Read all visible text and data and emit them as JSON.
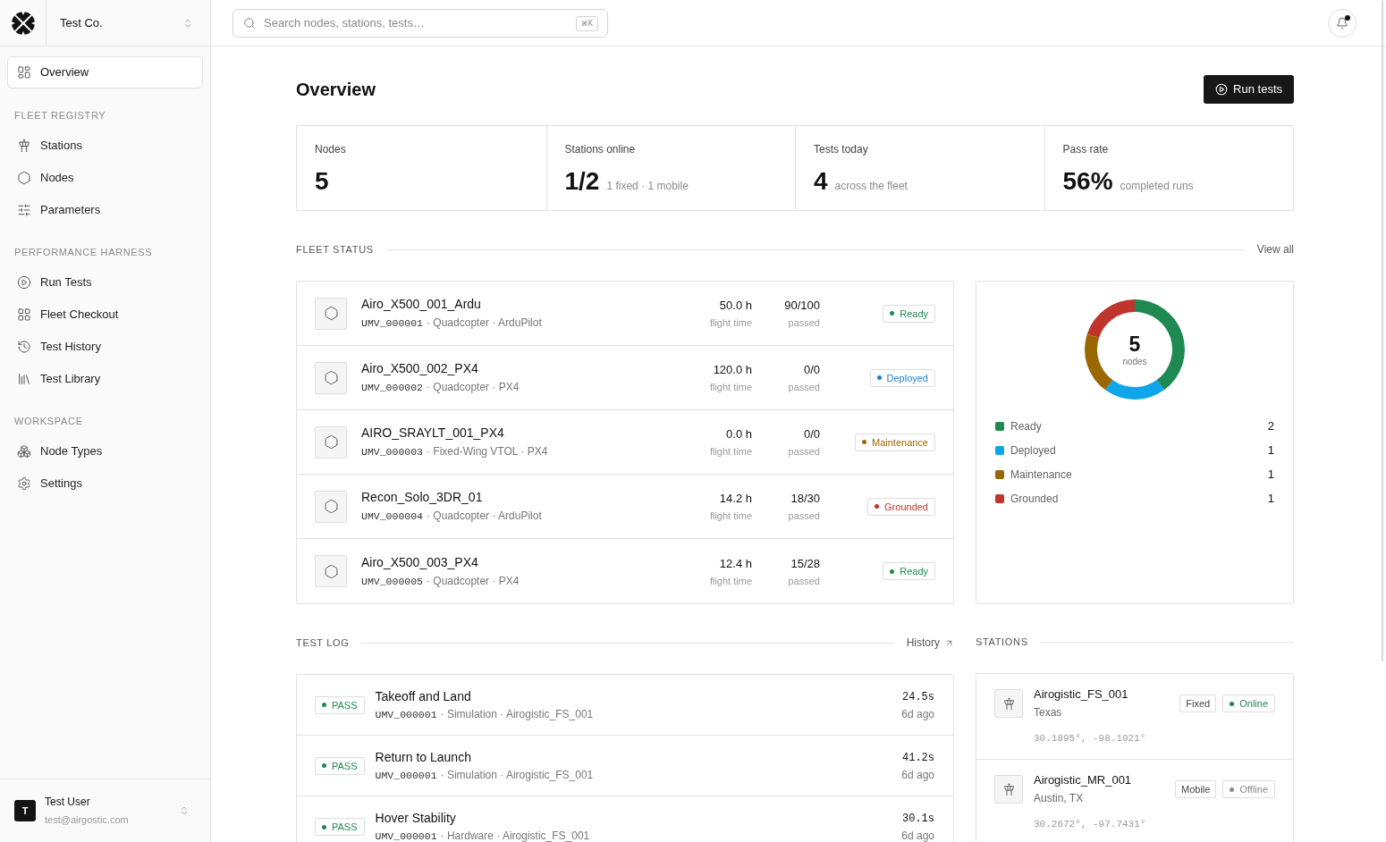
{
  "sidebar": {
    "company": "Test Co.",
    "top_items": [
      {
        "label": "Overview",
        "selected": true
      }
    ],
    "sections": [
      {
        "title": "FLEET REGISTRY",
        "items": [
          {
            "label": "Stations",
            "selected": false
          },
          {
            "label": "Nodes",
            "selected": false
          },
          {
            "label": "Parameters",
            "selected": false
          }
        ]
      },
      {
        "title": "PERFORMANCE HARNESS",
        "items": [
          {
            "label": "Run Tests",
            "selected": false
          },
          {
            "label": "Fleet Checkout",
            "selected": false
          },
          {
            "label": "Test History",
            "selected": false
          },
          {
            "label": "Test Library",
            "selected": false
          }
        ]
      },
      {
        "title": "WORKSPACE",
        "items": [
          {
            "label": "Node Types",
            "selected": false
          },
          {
            "label": "Settings",
            "selected": false
          }
        ]
      }
    ],
    "user": {
      "initial": "T",
      "name": "Test User",
      "email": "test@airgostic.com"
    }
  },
  "header": {
    "search": {
      "placeholder": "Search nodes, stations, tests…",
      "shortcut": "⌘K"
    },
    "notifications": {
      "unread": true
    }
  },
  "page": {
    "title": "Overview",
    "action": "Run tests"
  },
  "stats": [
    {
      "label": "Nodes",
      "value": "5"
    },
    {
      "label": "Stations online",
      "value": "1/2",
      "note": "1 fixed · 1 mobile"
    },
    {
      "label": "Tests today",
      "value": "4",
      "note": "across the fleet"
    },
    {
      "label": "Pass rate",
      "value": "56%",
      "note": "completed runs"
    }
  ],
  "fleet_status": {
    "title": "FLEET STATUS",
    "link": "View all",
    "nodes": [
      {
        "name": "Airo_X500_001_Ardu",
        "id": "UMV_000001",
        "meta": "· Quadcopter · ArduPilot",
        "flight_time": "50.0 h",
        "flight_time_label": "flight time",
        "passed": "90/100",
        "passed_label": "passed",
        "status": "Ready",
        "color": "#1e8a52"
      },
      {
        "name": "Airo_X500_002_PX4",
        "id": "UMV_000002",
        "meta": "· Quadcopter · PX4",
        "flight_time": "120.0 h",
        "flight_time_label": "flight time",
        "passed": "0/0",
        "passed_label": "passed",
        "status": "Deployed",
        "color": "#1a7fd0"
      },
      {
        "name": "AIRO_SRAYLT_001_PX4",
        "id": "UMV_000003",
        "meta": "· Fixed-Wing VTOL · PX4",
        "flight_time": "0.0 h",
        "flight_time_label": "flight time",
        "passed": "0/0",
        "passed_label": "passed",
        "status": "Maintenance",
        "color": "#9a6700"
      },
      {
        "name": "Recon_Solo_3DR_01",
        "id": "UMV_000004",
        "meta": "· Quadcopter · ArduPilot",
        "flight_time": "14.2 h",
        "flight_time_label": "flight time",
        "passed": "18/30",
        "passed_label": "passed",
        "status": "Grounded",
        "color": "#c0352b"
      },
      {
        "name": "Airo_X500_003_PX4",
        "id": "UMV_000005",
        "meta": "· Quadcopter · PX4",
        "flight_time": "12.4 h",
        "flight_time_label": "flight time",
        "passed": "15/28",
        "passed_label": "passed",
        "status": "Ready",
        "color": "#1e8a52"
      }
    ],
    "summary": {
      "total": "5",
      "total_label": "nodes",
      "chart_data": {
        "type": "donut",
        "values": [
          40,
          20,
          20,
          20
        ]
      },
      "legend": [
        {
          "label": "Ready",
          "count": "2",
          "color": "#1e8a52"
        },
        {
          "label": "Deployed",
          "count": "1",
          "color": "#0ea5e9"
        },
        {
          "label": "Maintenance",
          "count": "1",
          "color": "#9a6700"
        },
        {
          "label": "Grounded",
          "count": "1",
          "color": "#c0352b"
        }
      ]
    }
  },
  "test_log": {
    "title": "TEST LOG",
    "link": "History",
    "runs": [
      {
        "result": "PASS",
        "passed": true,
        "title": "Takeoff and Land",
        "node": "UMV_000001",
        "meta": "· Simulation · Airogistic_FS_001",
        "duration": "24.5s",
        "ago": "6d ago"
      },
      {
        "result": "PASS",
        "passed": true,
        "title": "Return to Launch",
        "node": "UMV_000001",
        "meta": "· Simulation · Airogistic_FS_001",
        "duration": "41.2s",
        "ago": "6d ago"
      },
      {
        "result": "PASS",
        "passed": true,
        "title": "Hover Stability",
        "node": "UMV_000001",
        "meta": "· Hardware · Airogistic_FS_001",
        "duration": "30.1s",
        "ago": "6d ago"
      }
    ]
  },
  "stations": {
    "title": "STATIONS",
    "items": [
      {
        "name": "Airogistic_FS_001",
        "location": "Texas",
        "mode": "Fixed",
        "status": "Online",
        "online": true,
        "coordinates": "30.1895°, -98.1021°"
      },
      {
        "name": "Airogistic_MR_001",
        "location": "Austin, TX",
        "mode": "Mobile",
        "status": "Offline",
        "online": false,
        "coordinates": "30.2672°, -97.7431°"
      }
    ]
  }
}
